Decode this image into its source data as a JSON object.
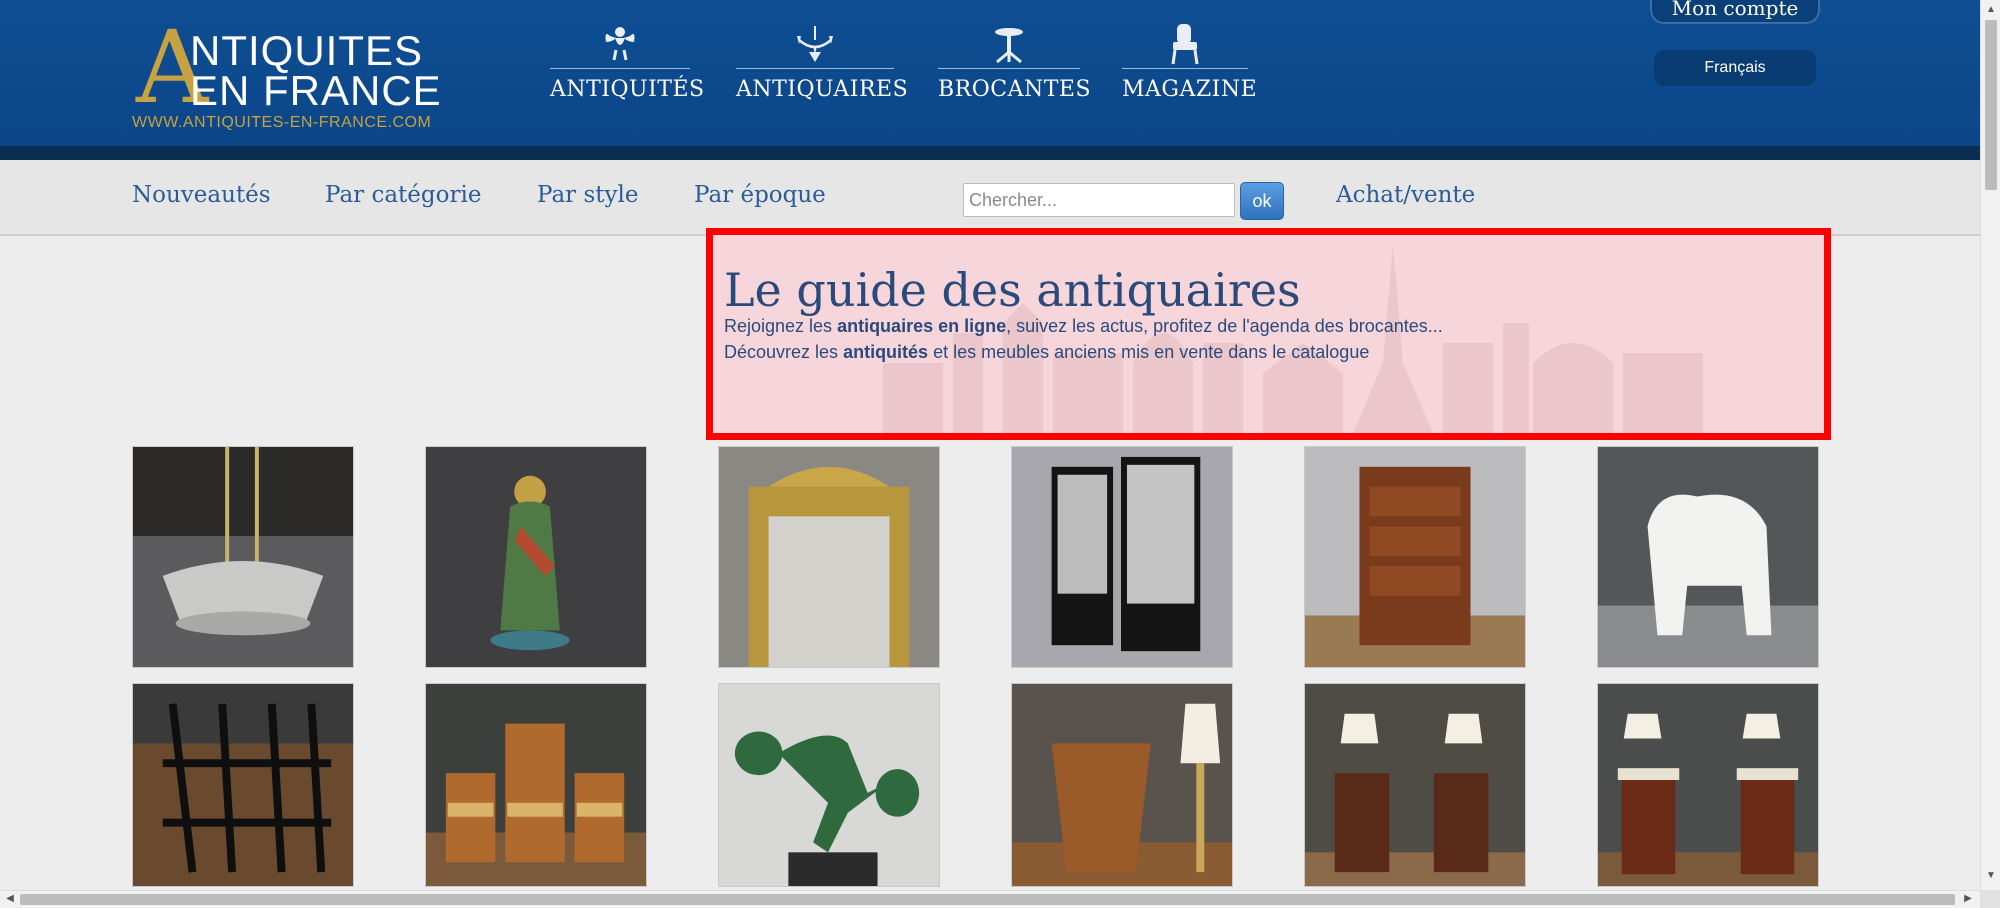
{
  "logo": {
    "big_letter": "A",
    "line1": "NTIQUITES",
    "line2": "EN FRANCE",
    "url": "WWW.ANTIQUITES-EN-FRANCE.COM"
  },
  "main_nav": [
    {
      "label": "ANTIQUITÉS",
      "icon": "cherub-icon"
    },
    {
      "label": "ANTIQUAIRES",
      "icon": "chandelier-icon"
    },
    {
      "label": "BROCANTES",
      "icon": "gueridon-table-icon"
    },
    {
      "label": "MAGAZINE",
      "icon": "armchair-icon"
    }
  ],
  "account": {
    "label": "Mon compte"
  },
  "language": {
    "label": "Français"
  },
  "subnav": {
    "links": [
      "Nouveautés",
      "Par catégorie",
      "Par style",
      "Par époque"
    ],
    "search_placeholder": "Chercher...",
    "search_button": "ok",
    "buy_sell": "Achat/vente"
  },
  "guide": {
    "title": "Le guide des antiquaires",
    "line1_pre": "Rejoignez les ",
    "line1_bold": "antiquaires en ligne",
    "line1_post": ", suivez les actus, profitez de l'agenda des brocantes...",
    "line2_pre": "Découvrez les ",
    "line2_bold": "antiquités",
    "line2_post": " et les meubles anciens mis en vente dans le catalogue"
  },
  "products": [
    {
      "name": "chandelier-lamp-photo"
    },
    {
      "name": "asian-figurine-photo"
    },
    {
      "name": "gilded-mirror-photo"
    },
    {
      "name": "display-cabinets-photo"
    },
    {
      "name": "marquetry-secretaire-photo"
    },
    {
      "name": "white-bear-sculpture-photo"
    },
    {
      "name": "black-magazine-rack-photo"
    },
    {
      "name": "straw-chairs-set-photo"
    },
    {
      "name": "bronze-dancer-statue-photo"
    },
    {
      "name": "leather-wastebasket-photo"
    },
    {
      "name": "pair-nightstands-lamps-photo"
    },
    {
      "name": "marble-top-nightstands-photo"
    }
  ],
  "colors": {
    "header_blue": "#0f4e93",
    "header_band": "#0a2d52",
    "gold": "#c6a240",
    "link_blue": "#2b5c99",
    "highlight_border": "#ff0000",
    "highlight_fill": "#f6d6da"
  }
}
